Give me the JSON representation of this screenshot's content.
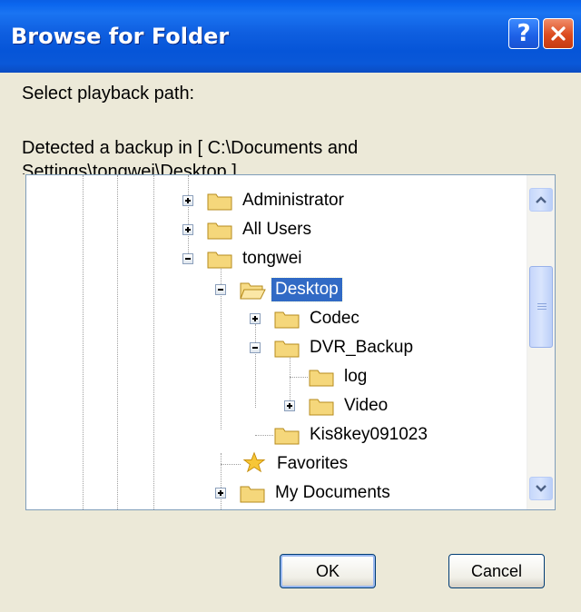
{
  "window": {
    "title": "Browse for Folder"
  },
  "titlebar_buttons": {
    "help_label": "?",
    "close_icon": "close-icon"
  },
  "prompt": "Select playback path:",
  "detected_text": "Detected a backup in [ C:\\Documents and Settings\\tongwei\\Desktop ]",
  "tree": {
    "items": [
      {
        "label": "Administrator",
        "expander": "plus",
        "icon": "folder-icon"
      },
      {
        "label": "All Users",
        "expander": "plus",
        "icon": "folder-icon"
      },
      {
        "label": "tongwei",
        "expander": "minus",
        "icon": "folder-icon"
      },
      {
        "label": "Desktop",
        "expander": "minus",
        "icon": "folder-open-icon",
        "selected": true
      },
      {
        "label": "Codec",
        "expander": "plus",
        "icon": "folder-icon"
      },
      {
        "label": "DVR_Backup",
        "expander": "minus",
        "icon": "folder-icon"
      },
      {
        "label": "log",
        "expander": "none",
        "icon": "folder-icon"
      },
      {
        "label": "Video",
        "expander": "plus",
        "icon": "folder-icon"
      },
      {
        "label": "Kis8key091023",
        "expander": "none",
        "icon": "folder-icon"
      },
      {
        "label": "Favorites",
        "expander": "none",
        "icon": "star-icon"
      },
      {
        "label": "My Documents",
        "expander": "plus",
        "icon": "folder-icon"
      }
    ]
  },
  "buttons": {
    "ok": "OK",
    "cancel": "Cancel"
  },
  "colors": {
    "title_blue": "#0a58d8",
    "selection": "#316ac5",
    "dialog_bg": "#ece9d8"
  }
}
